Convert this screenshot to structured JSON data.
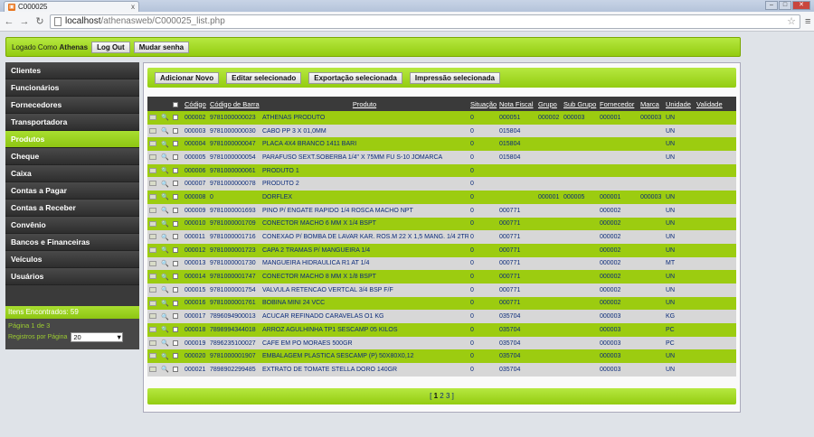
{
  "browser": {
    "tab_title": "C000025",
    "tab_close": "x",
    "url_host": "localhost",
    "url_path": "/athenasweb/C000025_list.php"
  },
  "topbar": {
    "logged_prefix": "Logado Como",
    "user": "Athenas",
    "logout": "Log Out",
    "change_password": "Mudar senha"
  },
  "sidebar": {
    "items": [
      {
        "label": "Clientes"
      },
      {
        "label": "Funcionários"
      },
      {
        "label": "Fornecedores"
      },
      {
        "label": "Transportadora"
      },
      {
        "label": "Produtos",
        "active": true
      },
      {
        "label": "Cheque"
      },
      {
        "label": "Caixa"
      },
      {
        "label": "Contas a Pagar"
      },
      {
        "label": "Contas a Receber"
      },
      {
        "label": "Convênio"
      },
      {
        "label": "Bancos e Financeiras"
      },
      {
        "label": "Veículos"
      },
      {
        "label": "Usuários"
      }
    ],
    "found": "Itens Encontrados: 59",
    "page": "Página 1 de 3",
    "per_page_label": "Registros por Página",
    "per_page_value": "20"
  },
  "actions": {
    "add": "Adicionar Novo",
    "edit": "Editar selecionado",
    "export": "Exportação selecionada",
    "print": "Impressão selecionada"
  },
  "grid": {
    "headers": [
      "Código",
      "Código de Barra",
      "Produto",
      "Situação",
      "Nota Fiscal",
      "Grupo",
      "Sub Grupo",
      "Fornecedor",
      "Marca",
      "Unidade",
      "Validade"
    ],
    "rows": [
      [
        "000002",
        "9781000000023",
        "ATHENAS PRODUTO",
        "0",
        "000051",
        "000002",
        "000003",
        "000001",
        "000003",
        "UN",
        ""
      ],
      [
        "000003",
        "9781000000030",
        "CABO PP 3 X 01,0MM",
        "0",
        "015804",
        "",
        "",
        "",
        "",
        "UN",
        ""
      ],
      [
        "000004",
        "9781000000047",
        "PLACA 4X4 BRANCO 1411 BARI",
        "0",
        "015804",
        "",
        "",
        "",
        "",
        "UN",
        ""
      ],
      [
        "000005",
        "9781000000054",
        "PARAFUSO SEXT.SOBERBA 1/4\" X 75MM FU S-10 JOMARCA",
        "0",
        "015804",
        "",
        "",
        "",
        "",
        "UN",
        ""
      ],
      [
        "000006",
        "9781000000061",
        "PRODUTO 1",
        "0",
        "",
        "",
        "",
        "",
        "",
        "",
        ""
      ],
      [
        "000007",
        "9781000000078",
        "PRODUTO 2",
        "0",
        "",
        "",
        "",
        "",
        "",
        "",
        ""
      ],
      [
        "000008",
        "0",
        "DORFLEX",
        "0",
        "",
        "000001",
        "000005",
        "000001",
        "000003",
        "UN",
        ""
      ],
      [
        "000009",
        "9781000001693",
        "PINO P/ ENGATE RAPIDO 1/4 ROSCA MACHO NPT",
        "0",
        "000771",
        "",
        "",
        "000002",
        "",
        "UN",
        ""
      ],
      [
        "000010",
        "9781000001709",
        "CONECTOR MACHO 6 MM X 1/4 BSPT",
        "0",
        "000771",
        "",
        "",
        "000002",
        "",
        "UN",
        ""
      ],
      [
        "000011",
        "9781000001716",
        "CONEXAO P/ BOMBA DE LAVAR KAR. ROS.M 22 X 1,5 MANG. 1/4 2TR",
        "0",
        "000771",
        "",
        "",
        "000002",
        "",
        "UN",
        ""
      ],
      [
        "000012",
        "9781000001723",
        "CAPA 2 TRAMAS P/ MANGUEIRA 1/4",
        "0",
        "000771",
        "",
        "",
        "000002",
        "",
        "UN",
        ""
      ],
      [
        "000013",
        "9781000001730",
        "MANGUEIRA HIDRAULICA R1 AT 1/4",
        "0",
        "000771",
        "",
        "",
        "000002",
        "",
        "MT",
        ""
      ],
      [
        "000014",
        "9781000001747",
        "CONECTOR MACHO 8 MM X 1/8 BSPT",
        "0",
        "000771",
        "",
        "",
        "000002",
        "",
        "UN",
        ""
      ],
      [
        "000015",
        "9781000001754",
        "VALVULA RETENCAO VERTCAL 3/4 BSP F/F",
        "0",
        "000771",
        "",
        "",
        "000002",
        "",
        "UN",
        ""
      ],
      [
        "000016",
        "9781000001761",
        "BOBINA MINI 24 VCC",
        "0",
        "000771",
        "",
        "",
        "000002",
        "",
        "UN",
        ""
      ],
      [
        "000017",
        "7896094900013",
        "ACUCAR REFINADO CARAVELAS O1 KG",
        "0",
        "035704",
        "",
        "",
        "000003",
        "",
        "KG",
        ""
      ],
      [
        "000018",
        "7898994344018",
        "ARROZ AGULHINHA TP1 SESCAMP 05 KILOS",
        "0",
        "035704",
        "",
        "",
        "000003",
        "",
        "PC",
        ""
      ],
      [
        "000019",
        "7896235100027",
        "CAFE EM PO MORAES 500GR",
        "0",
        "035704",
        "",
        "",
        "000003",
        "",
        "PC",
        ""
      ],
      [
        "000020",
        "9781000001907",
        "EMBALAGEM PLASTICA SESCAMP (P) 50X80X0,12",
        "0",
        "035704",
        "",
        "",
        "000003",
        "",
        "UN",
        ""
      ],
      [
        "000021",
        "7898902299485",
        "EXTRATO DE TOMATE STELLA DORO 140GR",
        "0",
        "035704",
        "",
        "",
        "000003",
        "",
        "UN",
        ""
      ]
    ]
  },
  "pager": {
    "open": "[",
    "current": "1",
    "p2": "2",
    "p3": "3",
    "close": "]"
  }
}
